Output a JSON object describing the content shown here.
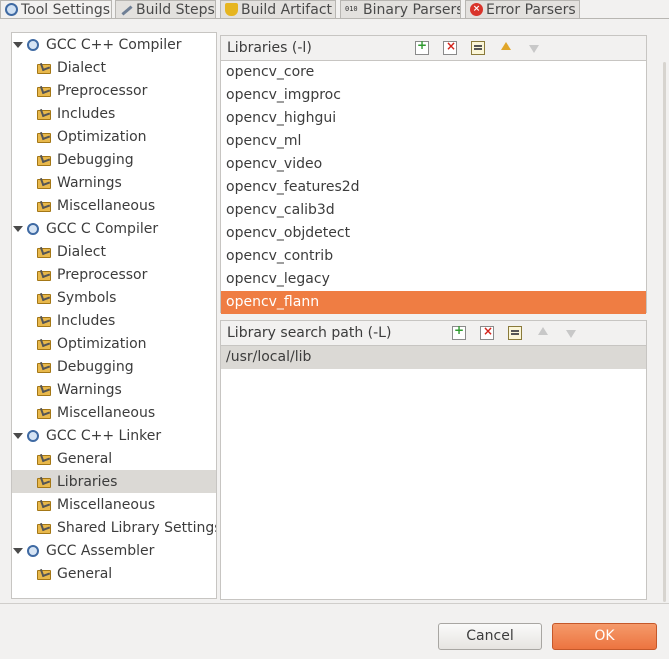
{
  "tabs": [
    {
      "label": "Tool Settings",
      "icon": "gear-icon"
    },
    {
      "label": "Build Steps",
      "icon": "wrench-icon"
    },
    {
      "label": "Build Artifact",
      "icon": "trophy-icon"
    },
    {
      "label": "Binary Parsers",
      "icon": "binary-icon"
    },
    {
      "label": "Error Parsers",
      "icon": "error-icon"
    }
  ],
  "tree": {
    "items": [
      {
        "label": "GCC C++ Compiler",
        "type": "category"
      },
      {
        "label": "Dialect",
        "type": "leaf"
      },
      {
        "label": "Preprocessor",
        "type": "leaf"
      },
      {
        "label": "Includes",
        "type": "leaf"
      },
      {
        "label": "Optimization",
        "type": "leaf"
      },
      {
        "label": "Debugging",
        "type": "leaf"
      },
      {
        "label": "Warnings",
        "type": "leaf"
      },
      {
        "label": "Miscellaneous",
        "type": "leaf"
      },
      {
        "label": "GCC C Compiler",
        "type": "category"
      },
      {
        "label": "Dialect",
        "type": "leaf"
      },
      {
        "label": "Preprocessor",
        "type": "leaf"
      },
      {
        "label": "Symbols",
        "type": "leaf"
      },
      {
        "label": "Includes",
        "type": "leaf"
      },
      {
        "label": "Optimization",
        "type": "leaf"
      },
      {
        "label": "Debugging",
        "type": "leaf"
      },
      {
        "label": "Warnings",
        "type": "leaf"
      },
      {
        "label": "Miscellaneous",
        "type": "leaf"
      },
      {
        "label": "GCC C++ Linker",
        "type": "category"
      },
      {
        "label": "General",
        "type": "leaf"
      },
      {
        "label": "Libraries",
        "type": "leaf",
        "selected": true
      },
      {
        "label": "Miscellaneous",
        "type": "leaf"
      },
      {
        "label": "Shared Library Settings",
        "type": "leaf"
      },
      {
        "label": "GCC Assembler",
        "type": "category"
      },
      {
        "label": "General",
        "type": "leaf"
      }
    ]
  },
  "libraries": {
    "title": "Libraries (-l)",
    "items": [
      "opencv_core",
      "opencv_imgproc",
      "opencv_highgui",
      "opencv_ml",
      "opencv_video",
      "opencv_features2d",
      "opencv_calib3d",
      "opencv_objdetect",
      "opencv_contrib",
      "opencv_legacy",
      "opencv_flann"
    ],
    "selected_index": 10
  },
  "library_search_path": {
    "title": "Library search path (-L)",
    "items": [
      "/usr/local/lib"
    ],
    "selected_index": 0
  },
  "buttons": {
    "cancel": "Cancel",
    "ok": "OK"
  },
  "colors": {
    "accent": "#ef7d43",
    "selection_gray": "#dbd9d5",
    "background": "#f2f1f0"
  }
}
